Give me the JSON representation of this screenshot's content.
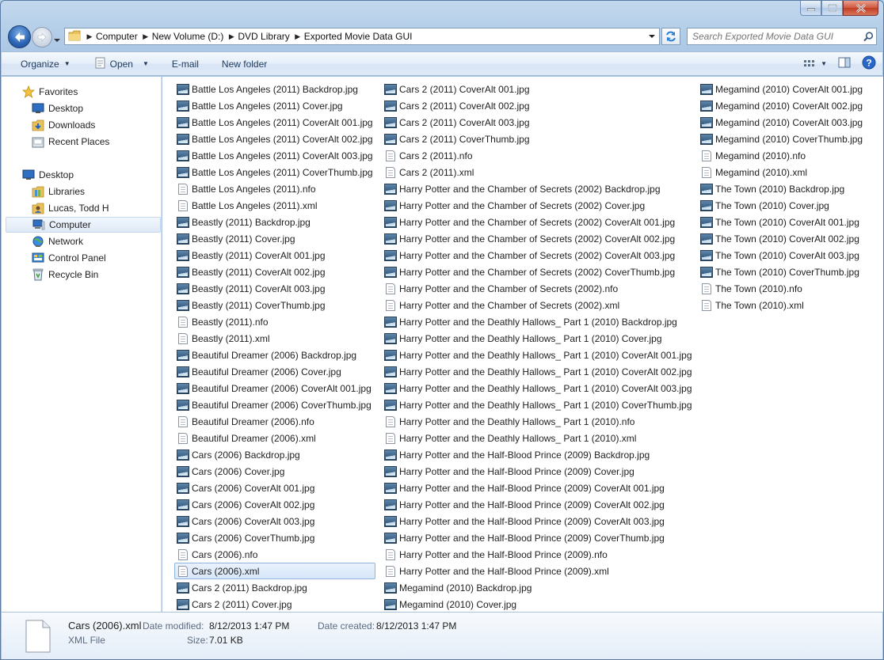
{
  "window": {
    "address": {
      "crumbs": [
        "Computer",
        "New Volume (D:)",
        "DVD Library",
        "Exported Movie Data GUI"
      ]
    },
    "search_placeholder": "Search Exported Movie Data GUI"
  },
  "toolbar": {
    "organize": "Organize",
    "open": "Open",
    "email": "E-mail",
    "new_folder": "New folder"
  },
  "nav": {
    "favorites": "Favorites",
    "desktop_fav": "Desktop",
    "downloads": "Downloads",
    "recent_places": "Recent Places",
    "desktop": "Desktop",
    "libraries": "Libraries",
    "user": "Lucas, Todd H",
    "computer": "Computer",
    "network": "Network",
    "control_panel": "Control Panel",
    "recycle_bin": "Recycle Bin"
  },
  "files": {
    "col1": [
      {
        "name": "Battle Los Angeles (2011) Backdrop.jpg",
        "type": "image"
      },
      {
        "name": "Battle Los Angeles (2011) Cover.jpg",
        "type": "image"
      },
      {
        "name": "Battle Los Angeles (2011) CoverAlt 001.jpg",
        "type": "image"
      },
      {
        "name": "Battle Los Angeles (2011) CoverAlt 002.jpg",
        "type": "image"
      },
      {
        "name": "Battle Los Angeles (2011) CoverAlt 003.jpg",
        "type": "image"
      },
      {
        "name": "Battle Los Angeles (2011) CoverThumb.jpg",
        "type": "image"
      },
      {
        "name": "Battle Los Angeles (2011).nfo",
        "type": "doc"
      },
      {
        "name": "Battle Los Angeles (2011).xml",
        "type": "doc"
      },
      {
        "name": "Beastly (2011) Backdrop.jpg",
        "type": "image"
      },
      {
        "name": "Beastly (2011) Cover.jpg",
        "type": "image"
      },
      {
        "name": "Beastly (2011) CoverAlt 001.jpg",
        "type": "image"
      },
      {
        "name": "Beastly (2011) CoverAlt 002.jpg",
        "type": "image"
      },
      {
        "name": "Beastly (2011) CoverAlt 003.jpg",
        "type": "image"
      },
      {
        "name": "Beastly (2011) CoverThumb.jpg",
        "type": "image"
      },
      {
        "name": "Beastly (2011).nfo",
        "type": "doc"
      },
      {
        "name": "Beastly (2011).xml",
        "type": "doc"
      },
      {
        "name": "Beautiful Dreamer (2006) Backdrop.jpg",
        "type": "image"
      },
      {
        "name": "Beautiful Dreamer (2006) Cover.jpg",
        "type": "image"
      },
      {
        "name": "Beautiful Dreamer (2006) CoverAlt 001.jpg",
        "type": "image"
      },
      {
        "name": "Beautiful Dreamer (2006) CoverThumb.jpg",
        "type": "image"
      },
      {
        "name": "Beautiful Dreamer (2006).nfo",
        "type": "doc"
      },
      {
        "name": "Beautiful Dreamer (2006).xml",
        "type": "doc"
      },
      {
        "name": "Cars (2006) Backdrop.jpg",
        "type": "image"
      },
      {
        "name": "Cars (2006) Cover.jpg",
        "type": "image"
      },
      {
        "name": "Cars (2006) CoverAlt 001.jpg",
        "type": "image"
      },
      {
        "name": "Cars (2006) CoverAlt 002.jpg",
        "type": "image"
      },
      {
        "name": "Cars (2006) CoverAlt 003.jpg",
        "type": "image"
      },
      {
        "name": "Cars (2006) CoverThumb.jpg",
        "type": "image"
      },
      {
        "name": "Cars (2006).nfo",
        "type": "doc"
      },
      {
        "name": "Cars (2006).xml",
        "type": "doc",
        "selected": true
      },
      {
        "name": "Cars 2 (2011) Backdrop.jpg",
        "type": "image"
      },
      {
        "name": "Cars 2 (2011) Cover.jpg",
        "type": "image"
      }
    ],
    "col2": [
      {
        "name": "Cars 2 (2011) CoverAlt 001.jpg",
        "type": "image"
      },
      {
        "name": "Cars 2 (2011) CoverAlt 002.jpg",
        "type": "image"
      },
      {
        "name": "Cars 2 (2011) CoverAlt 003.jpg",
        "type": "image"
      },
      {
        "name": "Cars 2 (2011) CoverThumb.jpg",
        "type": "image"
      },
      {
        "name": "Cars 2 (2011).nfo",
        "type": "doc"
      },
      {
        "name": "Cars 2 (2011).xml",
        "type": "doc"
      },
      {
        "name": "Harry Potter and the Chamber of Secrets (2002) Backdrop.jpg",
        "type": "image"
      },
      {
        "name": "Harry Potter and the Chamber of Secrets (2002) Cover.jpg",
        "type": "image"
      },
      {
        "name": "Harry Potter and the Chamber of Secrets (2002) CoverAlt 001.jpg",
        "type": "image"
      },
      {
        "name": "Harry Potter and the Chamber of Secrets (2002) CoverAlt 002.jpg",
        "type": "image"
      },
      {
        "name": "Harry Potter and the Chamber of Secrets (2002) CoverAlt 003.jpg",
        "type": "image"
      },
      {
        "name": "Harry Potter and the Chamber of Secrets (2002) CoverThumb.jpg",
        "type": "image"
      },
      {
        "name": "Harry Potter and the Chamber of Secrets (2002).nfo",
        "type": "doc"
      },
      {
        "name": "Harry Potter and the Chamber of Secrets (2002).xml",
        "type": "doc"
      },
      {
        "name": "Harry Potter and the Deathly Hallows_ Part 1 (2010) Backdrop.jpg",
        "type": "image"
      },
      {
        "name": "Harry Potter and the Deathly Hallows_ Part 1 (2010) Cover.jpg",
        "type": "image"
      },
      {
        "name": "Harry Potter and the Deathly Hallows_ Part 1 (2010) CoverAlt 001.jpg",
        "type": "image"
      },
      {
        "name": "Harry Potter and the Deathly Hallows_ Part 1 (2010) CoverAlt 002.jpg",
        "type": "image"
      },
      {
        "name": "Harry Potter and the Deathly Hallows_ Part 1 (2010) CoverAlt 003.jpg",
        "type": "image"
      },
      {
        "name": "Harry Potter and the Deathly Hallows_ Part 1 (2010) CoverThumb.jpg",
        "type": "image"
      },
      {
        "name": "Harry Potter and the Deathly Hallows_ Part 1 (2010).nfo",
        "type": "doc"
      },
      {
        "name": "Harry Potter and the Deathly Hallows_ Part 1 (2010).xml",
        "type": "doc"
      },
      {
        "name": "Harry Potter and the Half-Blood Prince (2009) Backdrop.jpg",
        "type": "image"
      },
      {
        "name": "Harry Potter and the Half-Blood Prince (2009) Cover.jpg",
        "type": "image"
      },
      {
        "name": "Harry Potter and the Half-Blood Prince (2009) CoverAlt 001.jpg",
        "type": "image"
      },
      {
        "name": "Harry Potter and the Half-Blood Prince (2009) CoverAlt 002.jpg",
        "type": "image"
      },
      {
        "name": "Harry Potter and the Half-Blood Prince (2009) CoverAlt 003.jpg",
        "type": "image"
      },
      {
        "name": "Harry Potter and the Half-Blood Prince (2009) CoverThumb.jpg",
        "type": "image"
      },
      {
        "name": "Harry Potter and the Half-Blood Prince (2009).nfo",
        "type": "doc"
      },
      {
        "name": "Harry Potter and the Half-Blood Prince (2009).xml",
        "type": "doc"
      },
      {
        "name": "Megamind (2010) Backdrop.jpg",
        "type": "image"
      },
      {
        "name": "Megamind (2010) Cover.jpg",
        "type": "image"
      }
    ],
    "col3": [
      {
        "name": "Megamind (2010) CoverAlt 001.jpg",
        "type": "image"
      },
      {
        "name": "Megamind (2010) CoverAlt 002.jpg",
        "type": "image"
      },
      {
        "name": "Megamind (2010) CoverAlt 003.jpg",
        "type": "image"
      },
      {
        "name": "Megamind (2010) CoverThumb.jpg",
        "type": "image"
      },
      {
        "name": "Megamind (2010).nfo",
        "type": "doc"
      },
      {
        "name": "Megamind (2010).xml",
        "type": "doc"
      },
      {
        "name": "The Town (2010) Backdrop.jpg",
        "type": "image"
      },
      {
        "name": "The Town (2010) Cover.jpg",
        "type": "image"
      },
      {
        "name": "The Town (2010) CoverAlt 001.jpg",
        "type": "image"
      },
      {
        "name": "The Town (2010) CoverAlt 002.jpg",
        "type": "image"
      },
      {
        "name": "The Town (2010) CoverAlt 003.jpg",
        "type": "image"
      },
      {
        "name": "The Town (2010) CoverThumb.jpg",
        "type": "image"
      },
      {
        "name": "The Town (2010).nfo",
        "type": "doc"
      },
      {
        "name": "The Town (2010).xml",
        "type": "doc"
      }
    ]
  },
  "details": {
    "filename": "Cars (2006).xml",
    "filetype": "XML File",
    "date_modified_label": "Date modified:",
    "date_modified": "8/12/2013 1:47 PM",
    "date_created_label": "Date created:",
    "date_created": "8/12/2013 1:47 PM",
    "size_label": "Size:",
    "size": "7.01 KB"
  }
}
